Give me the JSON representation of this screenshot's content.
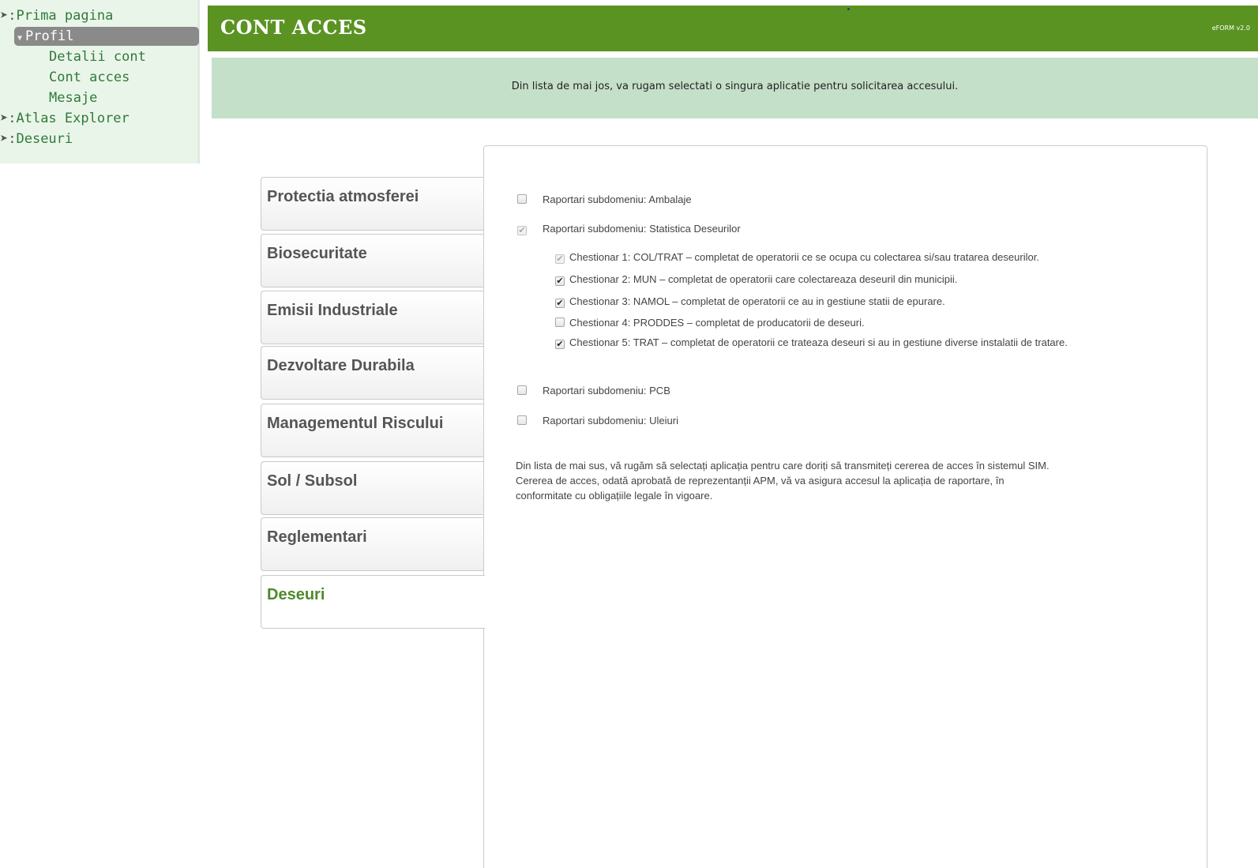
{
  "nav": {
    "items": [
      {
        "prefix": "➤:",
        "label": "Prima pagina"
      },
      {
        "arrow": "▼",
        "label": "Profil"
      },
      {
        "label": "Detalii cont"
      },
      {
        "label": "Cont acces"
      },
      {
        "label": "Mesaje"
      },
      {
        "prefix": "➤:",
        "label": "Atlas Explorer"
      },
      {
        "prefix": "➤:",
        "label": "Deseuri"
      }
    ]
  },
  "header": {
    "title": "CONT ACCES",
    "version": "eFORM v2.0"
  },
  "banner": {
    "text": "Din lista de mai jos, va rugam selectati o singura aplicatie pentru solicitarea accesului."
  },
  "tabs": [
    {
      "label": "Protectia atmosferei"
    },
    {
      "label": "Biosecuritate"
    },
    {
      "label": "Emisii Industriale"
    },
    {
      "label": "Dezvoltare Durabila"
    },
    {
      "label": "Managementul Riscului"
    },
    {
      "label": "Sol / Subsol"
    },
    {
      "label": "Reglementari"
    },
    {
      "label": "Deseuri"
    }
  ],
  "panel": {
    "options": [
      {
        "label": "Raportari subdomeniu: Ambalaje",
        "checked": false
      },
      {
        "label": "Raportari subdomeniu: Statistica Deseurilor",
        "checked": true,
        "disabled": true
      },
      {
        "label": "Raportari subdomeniu: PCB",
        "checked": false
      },
      {
        "label": "Raportari subdomeniu: Uleiuri",
        "checked": false
      }
    ],
    "sub_options": [
      {
        "label": "Chestionar 1: COL/TRAT – completat de operatorii ce se ocupa cu colectarea si/sau tratarea deseurilor.",
        "checked": true,
        "disabled": true
      },
      {
        "label": "Chestionar 2: MUN – completat de operatorii care colectareaza deseuril din municipii.",
        "checked": true
      },
      {
        "label": "Chestionar 3: NAMOL – completat de operatorii ce au in gestiune statii de epurare.",
        "checked": true
      },
      {
        "label": "Chestionar 4: PRODDES – completat de producatorii de deseuri.",
        "checked": false
      },
      {
        "label": "Chestionar 5: TRAT – completat de operatorii ce trateaza deseuri si au in gestiune diverse instalatii de tratare.",
        "checked": true
      }
    ],
    "note_lines": [
      "Din lista de mai sus, vă rugăm să selectați aplicația pentru care doriți să transmiteți cererea de acces în sistemul SIM.",
      "Cererea de acces, odată aprobată de reprezentanții APM, vă va asigura accesul la aplicația de raportare, în",
      "conformitate cu obligațiile legale în vigoare."
    ]
  }
}
